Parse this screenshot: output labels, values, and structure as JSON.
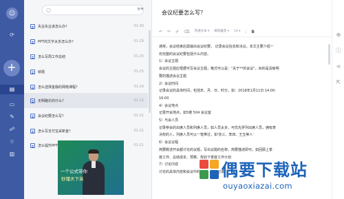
{
  "app": {
    "rail_icons": [
      {
        "name": "sync-icon",
        "glyph": "⟳"
      },
      {
        "name": "notes-icon",
        "glyph": "▤"
      },
      {
        "name": "folder-icon",
        "glyph": "▭"
      },
      {
        "name": "tag-icon",
        "glyph": "✎"
      },
      {
        "name": "share-icon",
        "glyph": "☍"
      },
      {
        "name": "star-icon",
        "glyph": "☆"
      },
      {
        "name": "trash-icon",
        "glyph": "▥"
      }
    ]
  },
  "note_list": {
    "items": [
      {
        "title": "失业失业该怎么办？",
        "date": "01-30",
        "selected": false
      },
      {
        "title": "PPT的文字太多怎么办？",
        "date": "01-29",
        "selected": false
      },
      {
        "title": "怎么写周工作总结",
        "date": "01-25",
        "selected": false
      },
      {
        "title": "就题",
        "date": "01-25",
        "selected": false
      },
      {
        "title": "怎么选择金融的网络课程？",
        "date": "01-24",
        "selected": false
      },
      {
        "title": "无明路乐的什么？",
        "date": "01-22",
        "selected": true
      },
      {
        "title": "会议纪要怎么写？",
        "date": "01-21",
        "selected": false
      },
      {
        "title": "怎么写支付宝采新金？",
        "date": "01-21",
        "selected": false
      },
      {
        "title": "怎么提升PPT的排版能力",
        "date": "01-21",
        "selected": false
      }
    ],
    "ad": {
      "caption_line1": "一个公式带你",
      "caption_line2": "秒懂天下英"
    }
  },
  "editor": {
    "title": "会议纪要怎么写？",
    "toolbar": {
      "undo": "↶",
      "redo": "↷",
      "brush": "✐",
      "clear": "⌫",
      "style": "普通文本 ▾",
      "font": "微软雅黑 ▾",
      "size": "14 ▾",
      "more": "⁝",
      "bold": "B"
    },
    "body": [
      "通常，会议结束后需输出会议纪要， 记录会议信息和决议，本文主要介绍一",
      "份完整的会议纪要包括什么内容。",
      "1）会议主题",
      "会议的主题应根据可写会议主题，格式可以是：\"关于**的会议\"，目的是清晰明",
      "要的描述会议主题",
      "2）会议时间",
      "记录会议的具体时间，包括年、月、日、时分，如：2018年1月11日 14:00-",
      "16:00",
      "4）会议地点",
      "记录开会地点，如5楼 504 会议室",
      "5）与会人员",
      "记录参会的出席人员和列席人员，如人员太多，可优先罗列出席人员，拥有表",
      "决权的人，列席人员可以一笔带过，如'张三、李四、王五等人'",
      "6）会议议程",
      "简要概述开会都讨论的议题，写出议题的名称，简要描述即可。如回顾上季",
      "度工作、总结成本、预算、规划下季度工作计划",
      "7）讨论内容",
      "讨论的具体内容和会议中的决议，补充记录"
    ]
  },
  "right_tools": [
    {
      "name": "attachment-icon",
      "glyph": "⊕"
    },
    {
      "name": "info-icon",
      "glyph": "ⓘ"
    },
    {
      "name": "share-icon",
      "glyph": "⋖"
    },
    {
      "name": "export-icon",
      "glyph": "⇱"
    }
  ],
  "watermark": {
    "brand": "偶要下载站",
    "url": "ouyaoxiazai.com",
    "colors": [
      "#e94b3c",
      "#f5a623",
      "#3b9a4c",
      "#1d63b8"
    ]
  },
  "colors": {
    "rail": "#3d5aa3",
    "accent": "#4a6fc9",
    "watermark": "#1d63b8"
  }
}
